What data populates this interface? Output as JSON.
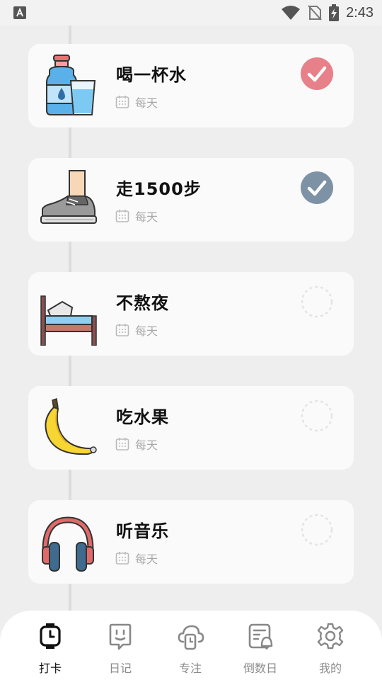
{
  "status_bar": {
    "time": "2:43",
    "left_icon": "a-notification-icon",
    "right_icons": [
      "wifi-icon",
      "no-sim-icon",
      "battery-charging-icon"
    ]
  },
  "habits": [
    {
      "title": "喝一杯水",
      "frequency": "每天",
      "icon": "water-bottle-glass",
      "checked": true,
      "check_color": "#e8808a"
    },
    {
      "title": "走1500步",
      "frequency": "每天",
      "icon": "sneaker-leg",
      "checked": true,
      "check_color": "#7e92a5"
    },
    {
      "title": "不熬夜",
      "frequency": "每天",
      "icon": "bed",
      "checked": false,
      "check_color": "#e4e4e4"
    },
    {
      "title": "吃水果",
      "frequency": "每天",
      "icon": "banana",
      "checked": false,
      "check_color": "#e4e4e4"
    },
    {
      "title": "听音乐",
      "frequency": "每天",
      "icon": "headphones",
      "checked": false,
      "check_color": "#e4e4e4"
    }
  ],
  "tabs": [
    {
      "label": "打卡",
      "icon": "watch-clock-icon",
      "active": true
    },
    {
      "label": "日记",
      "icon": "diary-face-icon",
      "active": false
    },
    {
      "label": "专注",
      "icon": "focus-timer-icon",
      "active": false
    },
    {
      "label": "倒数日",
      "icon": "countdown-calendar-icon",
      "active": false
    },
    {
      "label": "我的",
      "icon": "gear-icon",
      "active": false
    }
  ],
  "colors": {
    "background": "#eeeeee",
    "card": "#fafafa",
    "checked_red": "#e8808a",
    "checked_blue": "#7e92a5",
    "unchecked_ring": "#e4e4e4"
  }
}
